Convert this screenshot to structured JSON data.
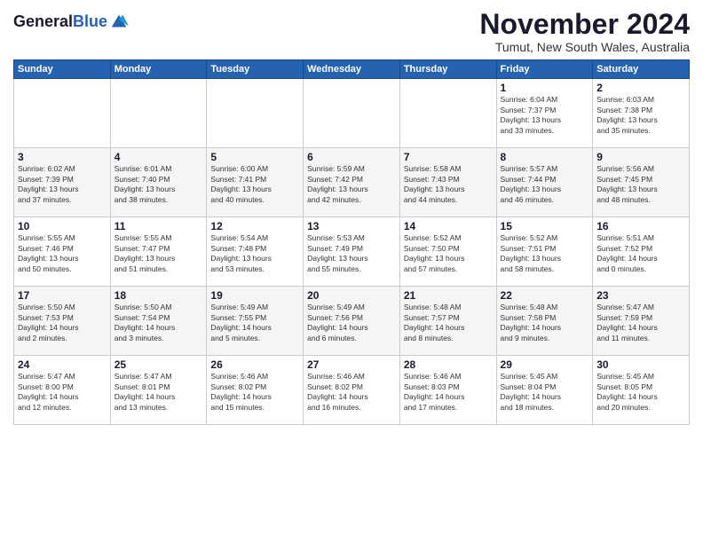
{
  "logo": {
    "line1": "General",
    "line2": "Blue"
  },
  "title": "November 2024",
  "subtitle": "Tumut, New South Wales, Australia",
  "weekdays": [
    "Sunday",
    "Monday",
    "Tuesday",
    "Wednesday",
    "Thursday",
    "Friday",
    "Saturday"
  ],
  "weeks": [
    [
      {
        "day": "",
        "detail": ""
      },
      {
        "day": "",
        "detail": ""
      },
      {
        "day": "",
        "detail": ""
      },
      {
        "day": "",
        "detail": ""
      },
      {
        "day": "",
        "detail": ""
      },
      {
        "day": "1",
        "detail": "Sunrise: 6:04 AM\nSunset: 7:37 PM\nDaylight: 13 hours\nand 33 minutes."
      },
      {
        "day": "2",
        "detail": "Sunrise: 6:03 AM\nSunset: 7:38 PM\nDaylight: 13 hours\nand 35 minutes."
      }
    ],
    [
      {
        "day": "3",
        "detail": "Sunrise: 6:02 AM\nSunset: 7:39 PM\nDaylight: 13 hours\nand 37 minutes."
      },
      {
        "day": "4",
        "detail": "Sunrise: 6:01 AM\nSunset: 7:40 PM\nDaylight: 13 hours\nand 38 minutes."
      },
      {
        "day": "5",
        "detail": "Sunrise: 6:00 AM\nSunset: 7:41 PM\nDaylight: 13 hours\nand 40 minutes."
      },
      {
        "day": "6",
        "detail": "Sunrise: 5:59 AM\nSunset: 7:42 PM\nDaylight: 13 hours\nand 42 minutes."
      },
      {
        "day": "7",
        "detail": "Sunrise: 5:58 AM\nSunset: 7:43 PM\nDaylight: 13 hours\nand 44 minutes."
      },
      {
        "day": "8",
        "detail": "Sunrise: 5:57 AM\nSunset: 7:44 PM\nDaylight: 13 hours\nand 46 minutes."
      },
      {
        "day": "9",
        "detail": "Sunrise: 5:56 AM\nSunset: 7:45 PM\nDaylight: 13 hours\nand 48 minutes."
      }
    ],
    [
      {
        "day": "10",
        "detail": "Sunrise: 5:55 AM\nSunset: 7:46 PM\nDaylight: 13 hours\nand 50 minutes."
      },
      {
        "day": "11",
        "detail": "Sunrise: 5:55 AM\nSunset: 7:47 PM\nDaylight: 13 hours\nand 51 minutes."
      },
      {
        "day": "12",
        "detail": "Sunrise: 5:54 AM\nSunset: 7:48 PM\nDaylight: 13 hours\nand 53 minutes."
      },
      {
        "day": "13",
        "detail": "Sunrise: 5:53 AM\nSunset: 7:49 PM\nDaylight: 13 hours\nand 55 minutes."
      },
      {
        "day": "14",
        "detail": "Sunrise: 5:52 AM\nSunset: 7:50 PM\nDaylight: 13 hours\nand 57 minutes."
      },
      {
        "day": "15",
        "detail": "Sunrise: 5:52 AM\nSunset: 7:51 PM\nDaylight: 13 hours\nand 58 minutes."
      },
      {
        "day": "16",
        "detail": "Sunrise: 5:51 AM\nSunset: 7:52 PM\nDaylight: 14 hours\nand 0 minutes."
      }
    ],
    [
      {
        "day": "17",
        "detail": "Sunrise: 5:50 AM\nSunset: 7:53 PM\nDaylight: 14 hours\nand 2 minutes."
      },
      {
        "day": "18",
        "detail": "Sunrise: 5:50 AM\nSunset: 7:54 PM\nDaylight: 14 hours\nand 3 minutes."
      },
      {
        "day": "19",
        "detail": "Sunrise: 5:49 AM\nSunset: 7:55 PM\nDaylight: 14 hours\nand 5 minutes."
      },
      {
        "day": "20",
        "detail": "Sunrise: 5:49 AM\nSunset: 7:56 PM\nDaylight: 14 hours\nand 6 minutes."
      },
      {
        "day": "21",
        "detail": "Sunrise: 5:48 AM\nSunset: 7:57 PM\nDaylight: 14 hours\nand 8 minutes."
      },
      {
        "day": "22",
        "detail": "Sunrise: 5:48 AM\nSunset: 7:58 PM\nDaylight: 14 hours\nand 9 minutes."
      },
      {
        "day": "23",
        "detail": "Sunrise: 5:47 AM\nSunset: 7:59 PM\nDaylight: 14 hours\nand 11 minutes."
      }
    ],
    [
      {
        "day": "24",
        "detail": "Sunrise: 5:47 AM\nSunset: 8:00 PM\nDaylight: 14 hours\nand 12 minutes."
      },
      {
        "day": "25",
        "detail": "Sunrise: 5:47 AM\nSunset: 8:01 PM\nDaylight: 14 hours\nand 13 minutes."
      },
      {
        "day": "26",
        "detail": "Sunrise: 5:46 AM\nSunset: 8:02 PM\nDaylight: 14 hours\nand 15 minutes."
      },
      {
        "day": "27",
        "detail": "Sunrise: 5:46 AM\nSunset: 8:02 PM\nDaylight: 14 hours\nand 16 minutes."
      },
      {
        "day": "28",
        "detail": "Sunrise: 5:46 AM\nSunset: 8:03 PM\nDaylight: 14 hours\nand 17 minutes."
      },
      {
        "day": "29",
        "detail": "Sunrise: 5:45 AM\nSunset: 8:04 PM\nDaylight: 14 hours\nand 18 minutes."
      },
      {
        "day": "30",
        "detail": "Sunrise: 5:45 AM\nSunset: 8:05 PM\nDaylight: 14 hours\nand 20 minutes."
      }
    ]
  ]
}
